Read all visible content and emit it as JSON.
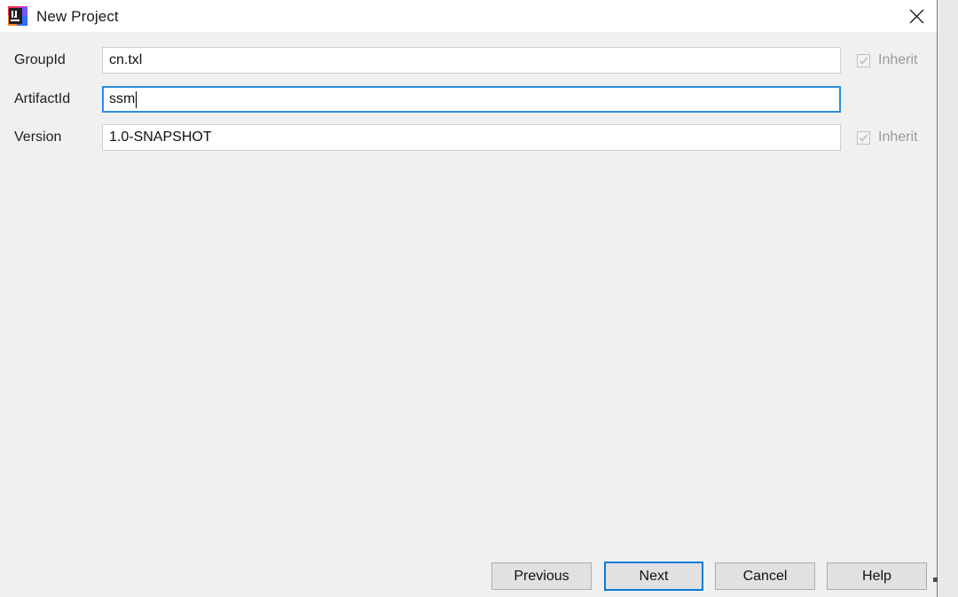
{
  "window": {
    "title": "New Project",
    "app_icon": "intellij-idea-logo",
    "close_icon": "close-icon"
  },
  "form": {
    "rows": [
      {
        "label": "GroupId",
        "value": "cn.txl",
        "focused": false,
        "inherit": {
          "label": "Inherit",
          "checked": true,
          "enabled": false
        }
      },
      {
        "label": "ArtifactId",
        "value": "ssm",
        "focused": true,
        "inherit": null
      },
      {
        "label": "Version",
        "value": "1.0-SNAPSHOT",
        "focused": false,
        "inherit": {
          "label": "Inherit",
          "checked": true,
          "enabled": false
        }
      }
    ]
  },
  "buttons": {
    "previous": "Previous",
    "next": "Next",
    "cancel": "Cancel",
    "help": "Help"
  },
  "colors": {
    "accent": "#0a7cd5",
    "field_focus_border": "#2d8ce0",
    "dialog_background": "#f0f0f0",
    "titlebar_background": "#ffffff",
    "button_face": "#e1e1e1",
    "disabled_text": "#9a9a9a"
  }
}
